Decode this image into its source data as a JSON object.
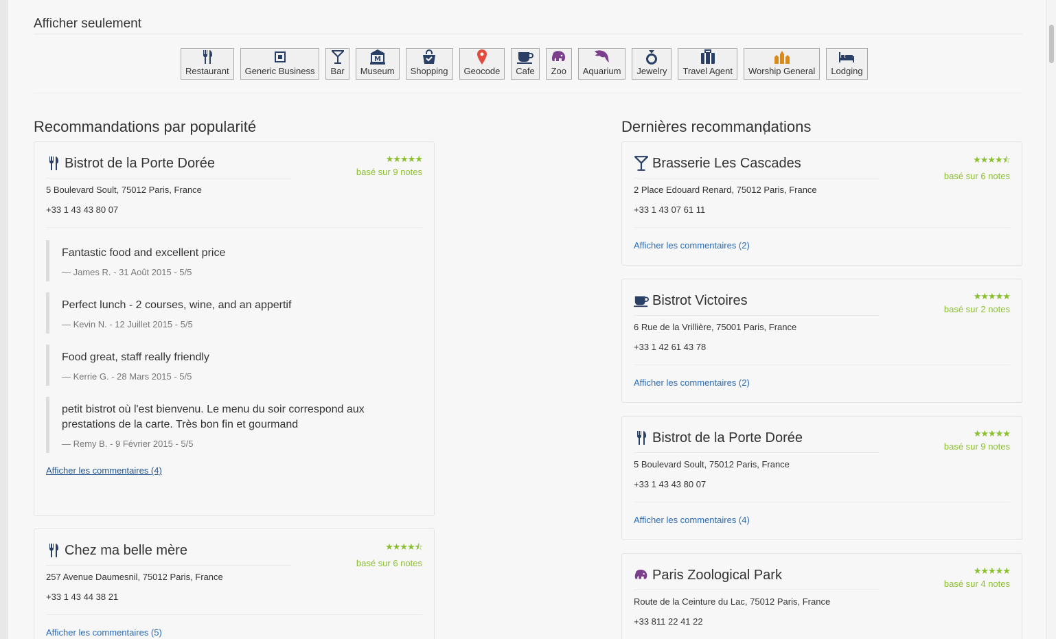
{
  "filters": {
    "title": "Afficher seulement",
    "items": [
      {
        "label": "Restaurant",
        "icon": "fork-knife-icon"
      },
      {
        "label": "Generic Business",
        "icon": "building-icon"
      },
      {
        "label": "Bar",
        "icon": "cocktail-glass-icon"
      },
      {
        "label": "Museum",
        "icon": "museum-icon"
      },
      {
        "label": "Shopping",
        "icon": "shopping-bag-icon"
      },
      {
        "label": "Geocode",
        "icon": "map-pin-icon"
      },
      {
        "label": "Cafe",
        "icon": "coffee-cup-icon"
      },
      {
        "label": "Zoo",
        "icon": "elephant-icon"
      },
      {
        "label": "Aquarium",
        "icon": "dolphin-icon"
      },
      {
        "label": "Jewelry",
        "icon": "ring-icon"
      },
      {
        "label": "Travel Agent",
        "icon": "suitcase-icon"
      },
      {
        "label": "Worship General",
        "icon": "worship-icon"
      },
      {
        "label": "Lodging",
        "icon": "bed-icon"
      }
    ]
  },
  "popular": {
    "title": "Recommandations par popularité",
    "cards": [
      {
        "name": "Bistrot de la Porte Dorée",
        "icon": "fork-knife-icon",
        "rating": 5,
        "stars": "★★★★★",
        "notes": "basé sur 9 notes",
        "address": "5 Boulevard Soult, 75012 Paris, France",
        "phone": "+33 1 43 43 80 07",
        "reviews": [
          {
            "text": "Fantastic food and excellent price",
            "meta": "— James R. - 31 Août 2015 - 5/5"
          },
          {
            "text": "Perfect lunch - 2 courses, wine, and an appertif",
            "meta": "— Kevin N. - 12 Juillet 2015 - 5/5"
          },
          {
            "text": "Food great, staff really friendly",
            "meta": "— Kerrie G. - 28 Mars 2015 - 5/5"
          },
          {
            "text": "petit bistrot où l'est bienvenu. Le menu du soir correspond aux prestations de la carte. Très bon fin et gourmand",
            "meta": "— Remy B. - 9 Février 2015 - 5/5"
          }
        ],
        "link": "Afficher les commentaires (4)"
      },
      {
        "name": "Chez ma belle mère",
        "icon": "fork-knife-icon",
        "rating": 4.5,
        "stars": "★★★★⯪",
        "notes": "basé sur 6 notes",
        "address": "257 Avenue Daumesnil, 75012 Paris, France",
        "phone": "+33 1 43 44 38 21",
        "link": "Afficher les commentaires (5)"
      }
    ]
  },
  "latest": {
    "title": "Dernières recommandations",
    "cards": [
      {
        "name": "Brasserie Les Cascades",
        "icon": "cocktail-glass-icon",
        "rating": 4.5,
        "stars": "★★★★⯪",
        "notes": "basé sur 6 notes",
        "address": "2 Place Edouard Renard, 75012 Paris, France",
        "phone": "+33 1 43 07 61 11",
        "link": "Afficher les commentaires (2)"
      },
      {
        "name": "Bistrot Victoires",
        "icon": "coffee-cup-icon",
        "rating": 5,
        "stars": "★★★★★",
        "notes": "basé sur 2 notes",
        "address": "6 Rue de la Vrillière, 75001 Paris, France",
        "phone": "+33 1 42 61 43 78",
        "link": "Afficher les commentaires (2)"
      },
      {
        "name": "Bistrot de la Porte Dorée",
        "icon": "fork-knife-icon",
        "rating": 5,
        "stars": "★★★★★",
        "notes": "basé sur 9 notes",
        "address": "5 Boulevard Soult, 75012 Paris, France",
        "phone": "+33 1 43 43 80 07",
        "link": "Afficher les commentaires (4)"
      },
      {
        "name": "Paris Zoological Park",
        "icon": "elephant-icon",
        "rating": 5,
        "stars": "★★★★★",
        "notes": "basé sur 4 notes",
        "address": "Route de la Ceinture du Lac, 75012 Paris, France",
        "phone": "+33 811 22 41 22"
      }
    ]
  },
  "colors": {
    "star_green": "#8bbf2e",
    "link_blue": "#2a6ab8",
    "icon_navy": "#2a3f66"
  }
}
